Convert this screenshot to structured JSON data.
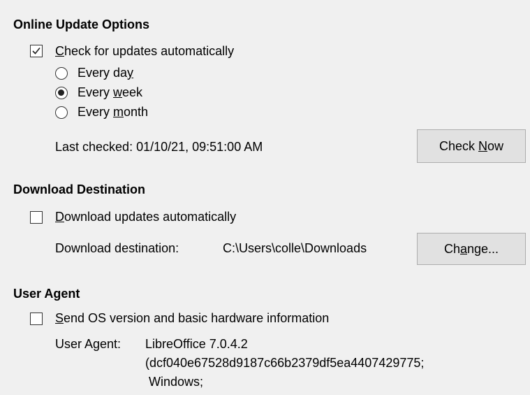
{
  "online_update": {
    "title": "Online Update Options",
    "check_auto": {
      "checked": true,
      "mnemonic": "C",
      "rest": "heck for updates automatically"
    },
    "options": [
      {
        "before": "Every da",
        "mnemonic": "y",
        "after": "",
        "selected": false
      },
      {
        "before": "Every ",
        "mnemonic": "w",
        "after": "eek",
        "selected": true
      },
      {
        "before": "Every ",
        "mnemonic": "m",
        "after": "onth",
        "selected": false
      }
    ],
    "last_checked": "Last checked: 01/10/21, 09:51:00 AM",
    "check_now": {
      "before": "Check ",
      "mnemonic": "N",
      "after": "ow"
    }
  },
  "download": {
    "title": "Download Destination",
    "download_auto": {
      "checked": false,
      "mnemonic": "D",
      "rest": "ownload updates automatically"
    },
    "destination_label": "Download destination:",
    "destination_path": "C:\\Users\\colle\\Downloads",
    "change": {
      "before": "Ch",
      "mnemonic": "a",
      "after": "nge..."
    }
  },
  "user_agent": {
    "title": "User Agent",
    "send_os": {
      "checked": false,
      "mnemonic": "S",
      "rest": "end OS version and basic hardware information"
    },
    "label": "User Agent:",
    "lines": [
      "LibreOffice 7.0.4.2",
      "(dcf040e67528d9187c66b2379df5ea4407429775;",
      " Windows;"
    ]
  }
}
